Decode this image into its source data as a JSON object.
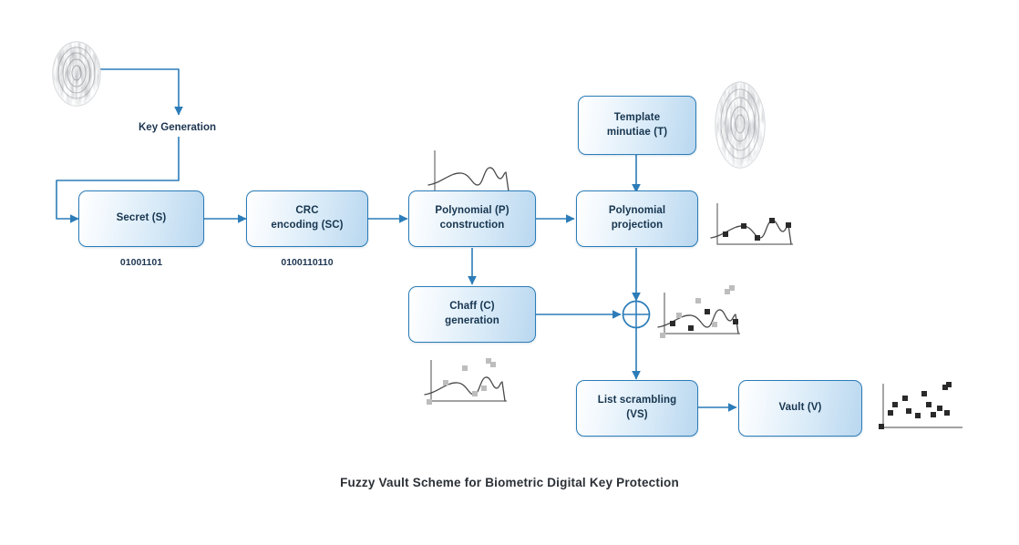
{
  "caption": "Fuzzy Vault Scheme for Biometric Digital Key Protection",
  "labels": {
    "key_generation": "Key Generation",
    "secret_bits": "01001101",
    "crc_bits": "0100110110"
  },
  "boxes": [
    {
      "id": "secret",
      "name": "secret-box",
      "lines": [
        "Secret (S)"
      ]
    },
    {
      "id": "crc",
      "name": "crc-encoding-box",
      "lines": [
        "CRC",
        "encoding (SC)"
      ]
    },
    {
      "id": "polyconst",
      "name": "polynomial-construction-box",
      "lines": [
        "Polynomial (P)",
        "construction"
      ]
    },
    {
      "id": "chaff",
      "name": "chaff-generation-box",
      "lines": [
        "Chaff (C)",
        "generation"
      ]
    },
    {
      "id": "template",
      "name": "template-minutiae-box",
      "lines": [
        "Template",
        "minutiae (T)"
      ]
    },
    {
      "id": "polyproj",
      "name": "polynomial-projection-box",
      "lines": [
        "Polynomial",
        "projection"
      ]
    },
    {
      "id": "scramble",
      "name": "list-scrambling-box",
      "lines": [
        "List scrambling",
        "(VS)"
      ]
    },
    {
      "id": "vault",
      "name": "vault-box",
      "lines": [
        "Vault (V)"
      ]
    }
  ],
  "icons": {
    "fingerprint_left": "fingerprint-icon",
    "fingerprint_right": "fingerprint-icon",
    "junction": "xor-junction-icon"
  },
  "thumbnails": [
    {
      "id": "poly-curve",
      "name": "polynomial-curve-thumbnail",
      "genuine_points": 0,
      "chaff_points": 0
    },
    {
      "id": "chaff-curve",
      "name": "chaff-points-thumbnail",
      "genuine_points": 0,
      "chaff_points": 7
    },
    {
      "id": "projection-curve",
      "name": "projection-points-thumbnail",
      "genuine_points": 5,
      "chaff_points": 0
    },
    {
      "id": "combined-curve",
      "name": "combined-points-thumbnail",
      "genuine_points": 4,
      "chaff_points": 6
    },
    {
      "id": "vault-scatter",
      "name": "vault-scatter-thumbnail",
      "genuine_points": 13,
      "chaff_points": 0
    }
  ],
  "colors": {
    "box_border": "#2b7cb8",
    "box_fill_light": "#ffffff",
    "box_fill_dark": "#b9d7ef",
    "connector": "#2b7cb8",
    "text": "#16354f",
    "caption_text": "#2b3036",
    "genuine_point": "#2a2a2a",
    "chaff_point": "#b0b0b0",
    "curve": "#4a4a4a"
  }
}
